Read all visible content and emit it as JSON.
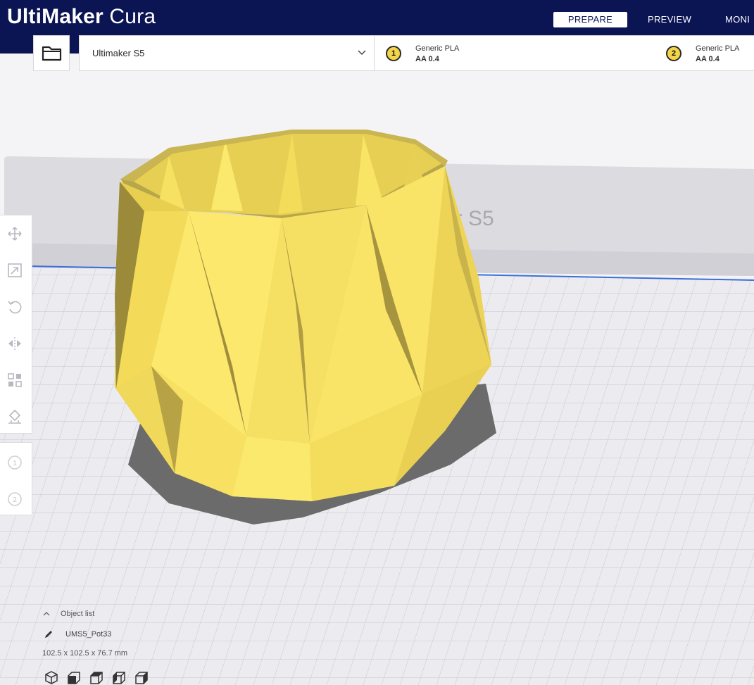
{
  "header": {
    "brand_bold": "UltiMaker",
    "brand_light": "Cura",
    "stages": [
      {
        "label": "PREPARE",
        "active": true
      },
      {
        "label": "PREVIEW",
        "active": false
      },
      {
        "label": "MONI",
        "active": false
      }
    ]
  },
  "printer_bar": {
    "printer_name": "Ultimaker S5",
    "extruders": [
      {
        "number": "1",
        "material": "Generic PLA",
        "core": "AA 0.4"
      },
      {
        "number": "2",
        "material": "Generic PLA",
        "core": "AA 0.4"
      }
    ]
  },
  "viewport": {
    "machine_label": "er S5",
    "model_color": "#f6e163",
    "plate_color": "#e9e9ee"
  },
  "toolbar": {
    "tools": [
      "move-icon",
      "scale-icon",
      "rotate-icon",
      "mirror-icon",
      "per-model-settings-icon",
      "support-blocker-icon"
    ],
    "extruder_selectors": [
      "1",
      "2"
    ]
  },
  "object_panel": {
    "toggle_label": "Object list",
    "object_name": "UMS5_Pot33",
    "dimensions": "102.5 x 102.5 x 76.7 mm",
    "view_buttons": [
      "3d-view-icon",
      "front-view-icon",
      "top-view-icon",
      "left-view-icon",
      "right-view-icon"
    ]
  }
}
